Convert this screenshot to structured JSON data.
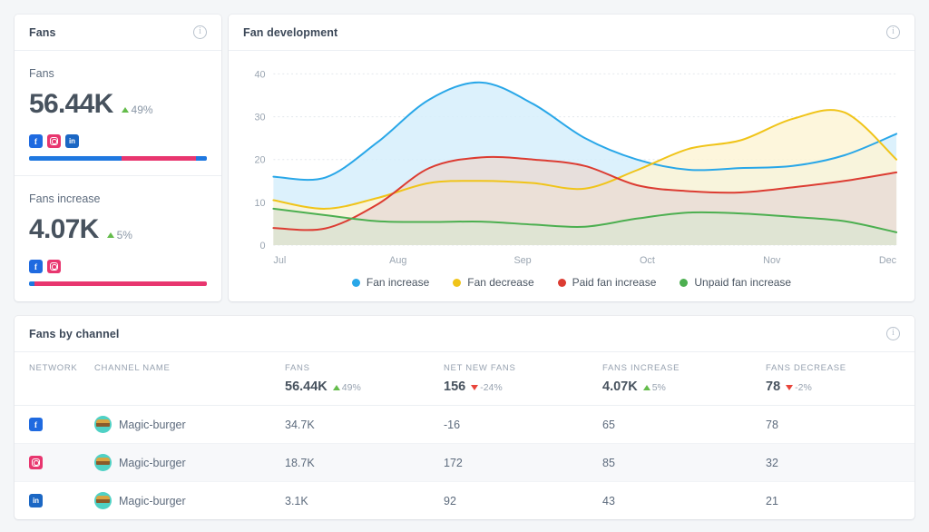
{
  "fans_card": {
    "title": "Fans",
    "info_icon": "info-icon",
    "metrics": [
      {
        "label": "Fans",
        "value": "56.44K",
        "delta": "49%",
        "direction": "up",
        "channels": [
          "facebook",
          "instagram",
          "linkedin"
        ],
        "distribution": [
          {
            "network": "facebook",
            "percent": 52,
            "color": "#1f78e0"
          },
          {
            "network": "instagram",
            "percent": 42,
            "color": "#e8366f"
          },
          {
            "network": "linkedin",
            "percent": 6,
            "color": "#1f78e0"
          }
        ]
      },
      {
        "label": "Fans increase",
        "value": "4.07K",
        "delta": "5%",
        "direction": "up",
        "channels": [
          "facebook",
          "instagram"
        ],
        "distribution": [
          {
            "network": "facebook",
            "percent": 3,
            "color": "#1f78e0"
          },
          {
            "network": "instagram",
            "percent": 97,
            "color": "#e8366f"
          }
        ]
      }
    ]
  },
  "chart_card": {
    "title": "Fan development",
    "info_icon": "info-icon"
  },
  "chart_data": {
    "type": "area",
    "title": "Fan development",
    "xlabel": "",
    "ylabel": "",
    "x": [
      "Jul",
      "Aug",
      "Sep",
      "Oct",
      "Nov",
      "Dec"
    ],
    "xticks": [
      "Jul",
      "Aug",
      "Sep",
      "Oct",
      "Nov",
      "Dec"
    ],
    "yticks": [
      0,
      10,
      20,
      30,
      40
    ],
    "ylim": [
      0,
      42
    ],
    "grid": true,
    "legend_position": "bottom",
    "series": [
      {
        "name": "Fan increase",
        "color": "#29a7e8",
        "fill": "#d6eefb",
        "values": [
          16,
          38,
          25,
          17.5,
          18.5,
          26
        ],
        "points": [
          16,
          15.8,
          24,
          34,
          38,
          33,
          25,
          20,
          17.6,
          18,
          18.5,
          21,
          26
        ]
      },
      {
        "name": "Fan decrease",
        "color": "#f0c419",
        "fill": "#fdf4d6",
        "values": [
          10.5,
          15,
          13.5,
          23,
          31,
          20
        ],
        "points": [
          10.5,
          8.5,
          11,
          14.5,
          15,
          14.5,
          13.2,
          17.5,
          22.5,
          24.5,
          29.5,
          31,
          20
        ]
      },
      {
        "name": "Paid fan increase",
        "color": "#dc3c32",
        "fill": "#e9dcd6",
        "values": [
          4,
          20.5,
          17.5,
          12.5,
          11.5,
          17
        ],
        "points": [
          4,
          3.9,
          9.5,
          18,
          20.5,
          20,
          18.5,
          14,
          12.6,
          12.3,
          13.5,
          15,
          17
        ]
      },
      {
        "name": "Unpaid fan increase",
        "color": "#4caf50",
        "fill": "#dde4d2",
        "values": [
          8.5,
          5.8,
          4.3,
          7.6,
          6.8,
          3
        ],
        "points": [
          8.5,
          7,
          5.6,
          5.4,
          5.5,
          4.8,
          4.3,
          6.2,
          7.6,
          7.4,
          6.6,
          5.6,
          3
        ]
      }
    ]
  },
  "table_card": {
    "title": "Fans by channel",
    "info_icon": "info-icon",
    "columns": [
      {
        "head": "NETWORK",
        "value": "",
        "delta": "",
        "direction": ""
      },
      {
        "head": "CHANNEL NAME",
        "value": "",
        "delta": "",
        "direction": ""
      },
      {
        "head": "FANS",
        "value": "56.44K",
        "delta": "49%",
        "direction": "up"
      },
      {
        "head": "NET NEW FANS",
        "value": "156",
        "delta": "-24%",
        "direction": "down"
      },
      {
        "head": "FANS INCREASE",
        "value": "4.07K",
        "delta": "5%",
        "direction": "up"
      },
      {
        "head": "FANS DECREASE",
        "value": "78",
        "delta": "-2%",
        "direction": "down"
      }
    ],
    "rows": [
      {
        "network": "facebook",
        "channel": "Magic-burger",
        "fans": "34.7K",
        "net_new_fans": "-16",
        "fans_increase": "65",
        "fans_decrease": "78"
      },
      {
        "network": "instagram",
        "channel": "Magic-burger",
        "fans": "18.7K",
        "net_new_fans": "172",
        "fans_increase": "85",
        "fans_decrease": "32"
      },
      {
        "network": "linkedin",
        "channel": "Magic-burger",
        "fans": "3.1K",
        "net_new_fans": "92",
        "fans_increase": "43",
        "fans_decrease": "21"
      }
    ]
  }
}
